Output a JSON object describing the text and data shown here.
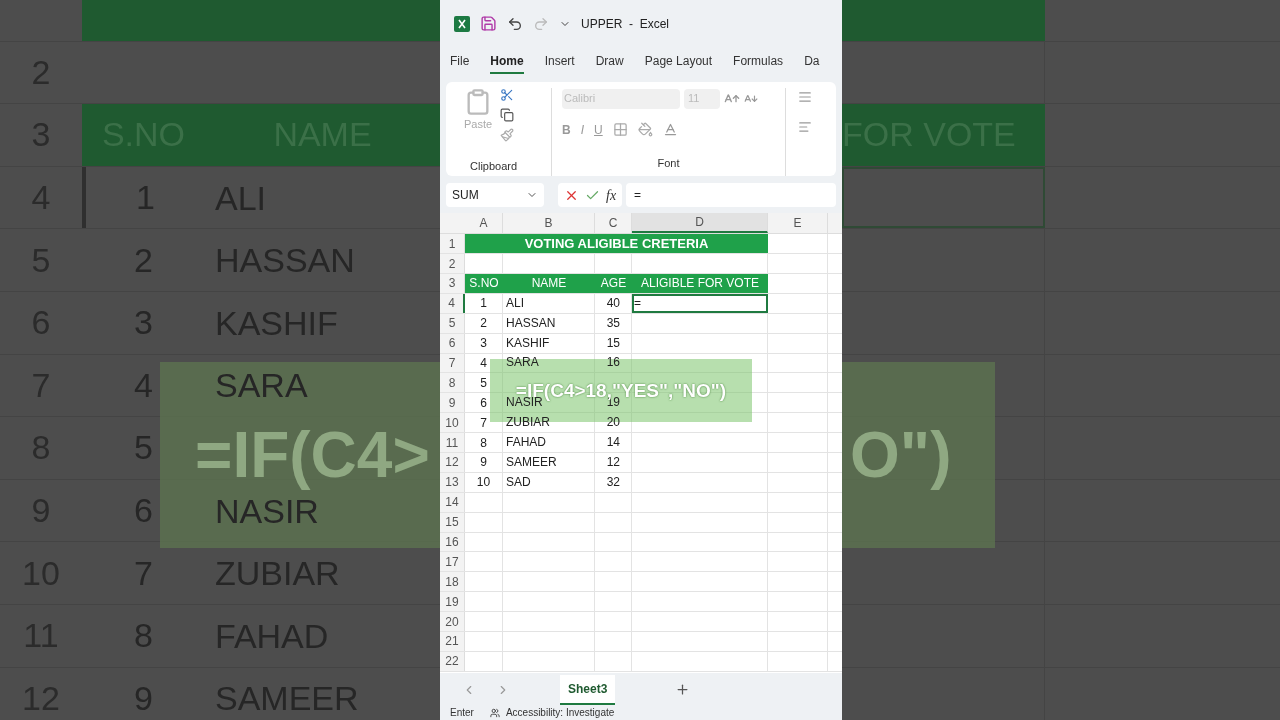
{
  "background": {
    "left": {
      "headers": [
        "S.NO",
        "NAME"
      ],
      "row_numbers": [
        "2",
        "3",
        "4",
        "5",
        "6",
        "7",
        "8",
        "9",
        "10",
        "11",
        "12"
      ],
      "rows": [
        {
          "sno": "1",
          "name": "ALI",
          "selected": true
        },
        {
          "sno": "2",
          "name": "HASSAN",
          "selected": false
        },
        {
          "sno": "3",
          "name": "KASHIF",
          "selected": false
        },
        {
          "sno": "4",
          "name": "SARA",
          "selected": false
        },
        {
          "sno": "5",
          "selected": false
        },
        {
          "sno": "6",
          "name": "NASIR",
          "selected": false
        },
        {
          "sno": "7",
          "name": "ZUBIAR",
          "selected": false
        },
        {
          "sno": "8",
          "name": "FAHAD",
          "selected": false
        },
        {
          "sno": "9",
          "name": "SAMEER",
          "selected": false
        }
      ],
      "caption": "=IF(C4>"
    },
    "right": {
      "header": "FOR VOTE",
      "caption": "O\")"
    }
  },
  "excel": {
    "title": "UPPER  -  Excel",
    "tabs": [
      {
        "label": "File",
        "selected": false
      },
      {
        "label": "Home",
        "selected": true
      },
      {
        "label": "Insert",
        "selected": false
      },
      {
        "label": "Draw",
        "selected": false
      },
      {
        "label": "Page Layout",
        "selected": false
      },
      {
        "label": "Formulas",
        "selected": false
      },
      {
        "label": "Da",
        "selected": false
      }
    ],
    "clipboard": {
      "paste": "Paste",
      "label": "Clipboard"
    },
    "font": {
      "name": "Calibri",
      "size": "11",
      "bold": "B",
      "italic": "I",
      "underline": "U",
      "label": "Font"
    },
    "formula_bar": {
      "name_box": "SUM",
      "fx": "fx",
      "value": "="
    },
    "sheet": {
      "columns": [
        {
          "label": "A",
          "selected": false
        },
        {
          "label": "B",
          "selected": false
        },
        {
          "label": "C",
          "selected": false
        },
        {
          "label": "D",
          "selected": true
        },
        {
          "label": "E",
          "selected": false
        }
      ],
      "row_numbers": [
        {
          "label": "1",
          "selected": false
        },
        {
          "label": "2",
          "selected": false
        },
        {
          "label": "3",
          "selected": false
        },
        {
          "label": "4",
          "selected": true
        },
        {
          "label": "5",
          "selected": false
        },
        {
          "label": "6",
          "selected": false
        },
        {
          "label": "7",
          "selected": false
        },
        {
          "label": "8",
          "selected": false
        },
        {
          "label": "9",
          "selected": false
        },
        {
          "label": "10",
          "selected": false
        },
        {
          "label": "11",
          "selected": false
        },
        {
          "label": "12",
          "selected": false
        },
        {
          "label": "13",
          "selected": false
        },
        {
          "label": "14",
          "selected": false
        },
        {
          "label": "15",
          "selected": false
        },
        {
          "label": "16",
          "selected": false
        },
        {
          "label": "17",
          "selected": false
        },
        {
          "label": "18",
          "selected": false
        },
        {
          "label": "19",
          "selected": false
        },
        {
          "label": "20",
          "selected": false
        },
        {
          "label": "21",
          "selected": false
        },
        {
          "label": "22",
          "selected": false
        }
      ],
      "title": "VOTING ALIGIBLE CRETERIA",
      "headers": [
        "S.NO",
        "NAME",
        "AGE",
        "ALIGIBLE FOR VOTE"
      ],
      "rows": [
        {
          "sno": "1",
          "name": "ALI",
          "age": "40",
          "value": "=",
          "selected": true
        },
        {
          "sno": "2",
          "name": "HASSAN",
          "age": "35",
          "selected": false
        },
        {
          "sno": "3",
          "name": "KASHIF",
          "age": "15",
          "selected": false
        },
        {
          "sno": "4",
          "name": "SARA",
          "age": "16",
          "selected": false
        },
        {
          "sno": "5",
          "selected": false
        },
        {
          "sno": "6",
          "name": "NASIR",
          "age": "19",
          "selected": false
        },
        {
          "sno": "7",
          "name": "ZUBIAR",
          "age": "20",
          "selected": false
        },
        {
          "sno": "8",
          "name": "FAHAD",
          "age": "14",
          "selected": false
        },
        {
          "sno": "9",
          "name": "SAMEER",
          "age": "12",
          "selected": false
        },
        {
          "sno": "10",
          "name": "SAD",
          "age": "32",
          "selected": false
        }
      ]
    },
    "caption": "=IF(C4>18,\"YES\",\"NO\")",
    "sheet_tabs": [
      {
        "label": "Sheet3",
        "selected": true
      }
    ],
    "status": {
      "mode": "Enter",
      "accessibility": "Accessibility: Investigate"
    }
  }
}
